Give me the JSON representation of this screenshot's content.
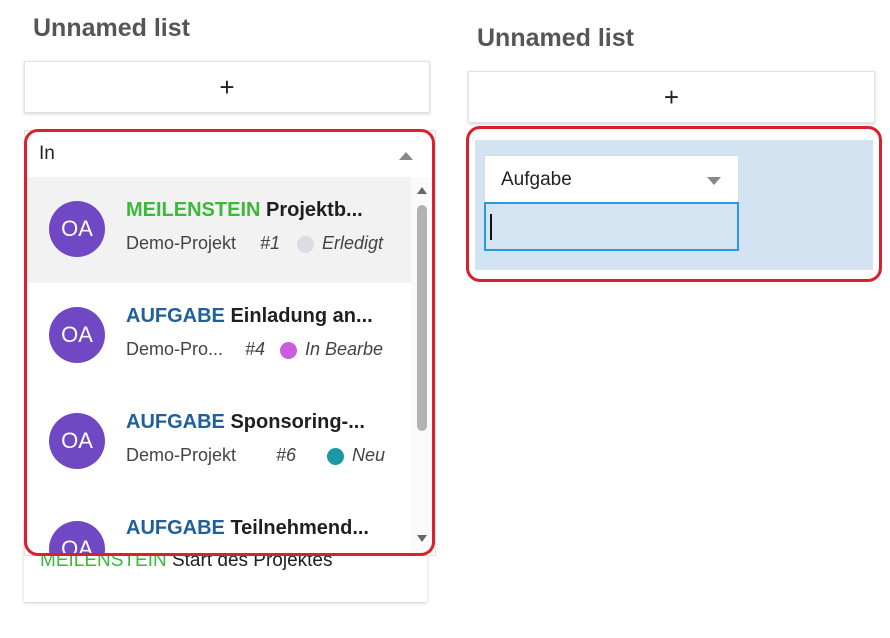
{
  "left_list": {
    "title": "Unnamed list",
    "add_label": "+",
    "search_value": "In",
    "card_below": {
      "type": "MEILENSTEIN",
      "name": "Start des Projektes"
    },
    "items": [
      {
        "avatar": "OA",
        "type": "MEILENSTEIN",
        "name": "Projektb...",
        "project": "Demo-Projekt",
        "number": "#1",
        "status": "Erledigt",
        "status_color": "#dcdde4"
      },
      {
        "avatar": "OA",
        "type": "AUFGABE",
        "name": "Einladung an...",
        "project": "Demo-Pro...",
        "number": "#4",
        "status": "In Bearbe",
        "status_color": "#c95ee0"
      },
      {
        "avatar": "OA",
        "type": "AUFGABE",
        "name": "Sponsoring-...",
        "project": "Demo-Projekt",
        "number": "#6",
        "status": "Neu",
        "status_color": "#1a98a8"
      },
      {
        "avatar": "OA",
        "type": "AUFGABE",
        "name": "Teilnehmend...",
        "project": "",
        "number": "",
        "status": "",
        "status_color": ""
      }
    ]
  },
  "right_list": {
    "title": "Unnamed list",
    "add_label": "+",
    "type_select_value": "Aufgabe",
    "text_input_value": ""
  },
  "colors": {
    "milestone": "#3cb83a",
    "task": "#1f5f9a",
    "avatar": "#7048c4",
    "highlight": "#d9202c",
    "input_focus": "#2a9ae0"
  }
}
